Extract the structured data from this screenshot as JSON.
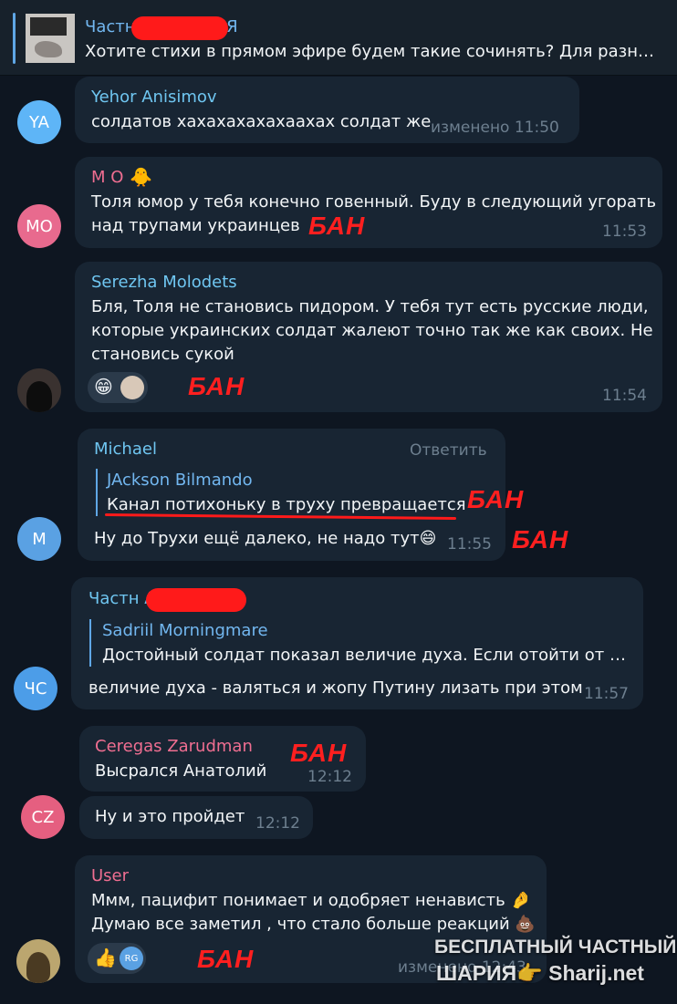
{
  "pinned": {
    "title": "Частн           АРИЯ",
    "text": "Хотите стихи в прямом эфире будем такие сочинять? Для разныв..."
  },
  "messages": [
    {
      "initials": "YA",
      "avatar_color": "#5eb5f7",
      "name": "Yehor Anisimov",
      "name_color": "#6fc6f1",
      "text": "солдатов хахахахахахаахах солдат же",
      "time": "изменено 11:50"
    },
    {
      "initials": "MO",
      "avatar_color": "#e86a8e",
      "name": "М О",
      "name_color": "#ef6e91",
      "text": "Толя юмор у тебя конечно говенный. Буду в следующий угорать\nнад трупами украинцев",
      "time": "11:53"
    },
    {
      "name": "Serezha Molodets",
      "name_color": "#6fc6f1",
      "text": "Бля, Толя не становись пидором. У тебя тут есть русские люди,\nкоторые украинских солдат жалеют точно так же как своих. Не\nстановись сукой",
      "time": "11:54"
    },
    {
      "initials": "M",
      "avatar_color": "#5aa1e3",
      "name": "Michael",
      "name_color": "#6fc6f1",
      "reply_action": "Ответить",
      "reply_name": "JAckson Bilmando",
      "reply_text": "Канал потихоньку в труху превращается",
      "text": "Ну до Трухи ещё далеко, не надо тут😄",
      "time": "11:55"
    },
    {
      "initials": "ЧС",
      "avatar_color": "#4c9de8",
      "name": "Частн           АРИЯ Chat",
      "name_color": "#6fc6f1",
      "reply_name": "Sadriil Morningmare",
      "reply_text": "Достойный солдат показал величие духа. Если отойти от пр...",
      "text": "величие духа - валяться и жопу Путину лизать при этом",
      "time": "11:57"
    },
    {
      "initials": "CZ",
      "avatar_color": "#e55f80",
      "name": "Ceregas Zarudman",
      "name_color": "#ef6e91",
      "text": "Высрался Анатолий",
      "time": "12:12",
      "text2": "Ну и это пройдет",
      "time2": "12:12"
    },
    {
      "name": "User",
      "name_color": "#ef6e91",
      "text": "Ммм, пацифит понимает и одобряет ненависть 🤌\nДумаю все заметил , что стало больше реакций 💩",
      "time": "изменено 12:43",
      "reaction_badge": "RG"
    }
  ],
  "ban_label": "БАН",
  "watermark": {
    "line1": "БЕСПЛАТНЫЙ ЧАСТНЫЙ",
    "line2": "ШАРИЯ👉 Sharij.net"
  }
}
